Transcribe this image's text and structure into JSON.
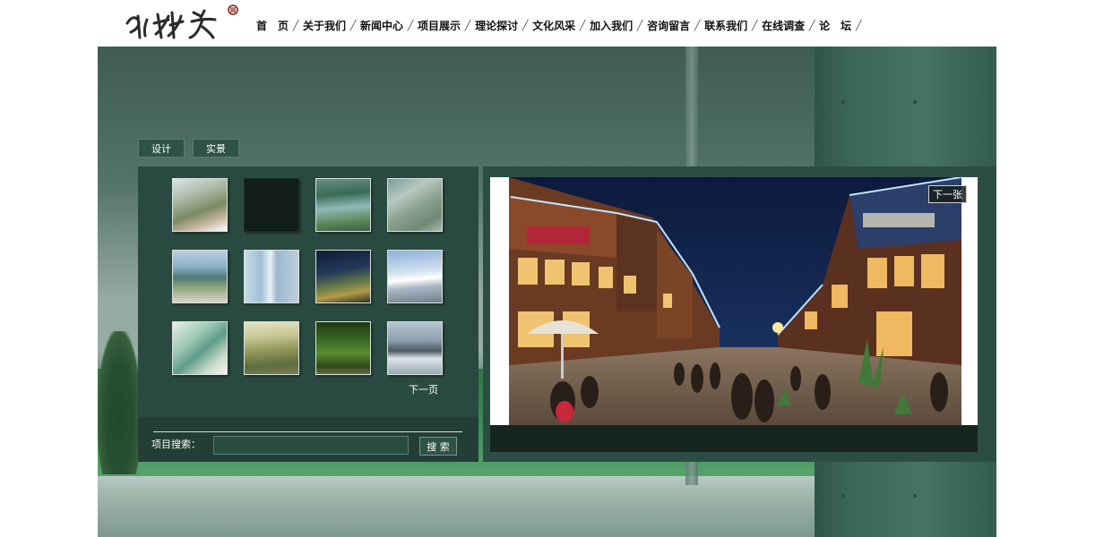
{
  "header": {
    "logo_icon": "calligraphy-logo",
    "nav": [
      {
        "label": "首　页"
      },
      {
        "label": "关于我们"
      },
      {
        "label": "新闻中心"
      },
      {
        "label": "项目展示"
      },
      {
        "label": "理论探讨"
      },
      {
        "label": "文化风采"
      },
      {
        "label": "加入我们"
      },
      {
        "label": "咨询留言"
      },
      {
        "label": "联系我们"
      },
      {
        "label": "在线调查"
      },
      {
        "label": "论　坛"
      }
    ],
    "separator": "╱"
  },
  "tabs": [
    {
      "label": "设计"
    },
    {
      "label": "实景"
    }
  ],
  "thumbnails": [
    {
      "icon": "aerial-resort-thumbnail"
    },
    {
      "icon": "blank-thumbnail"
    },
    {
      "icon": "lakeside-plan-thumbnail"
    },
    {
      "icon": "aerial-masterplan-thumbnail"
    },
    {
      "icon": "wetland-thumbnail"
    },
    {
      "icon": "towers-thumbnail"
    },
    {
      "icon": "night-complex-thumbnail"
    },
    {
      "icon": "exhibition-hall-thumbnail"
    },
    {
      "icon": "site-plan-thumbnail"
    },
    {
      "icon": "town-aerial-thumbnail"
    },
    {
      "icon": "forest-walkway-thumbnail"
    },
    {
      "icon": "modern-building-thumbnail"
    }
  ],
  "pager": {
    "next_page": "下一页"
  },
  "search": {
    "label": "项目搜索：",
    "value": "",
    "placeholder": "",
    "button": "搜 索"
  },
  "viewer": {
    "next_image": "下一张",
    "image_icon": "night-street-rendering",
    "caption": ""
  },
  "colors": {
    "panel": "#2a4a41",
    "panel_dark": "#223e36",
    "tab": "#2e5148",
    "accent_white": "#ffffff"
  }
}
